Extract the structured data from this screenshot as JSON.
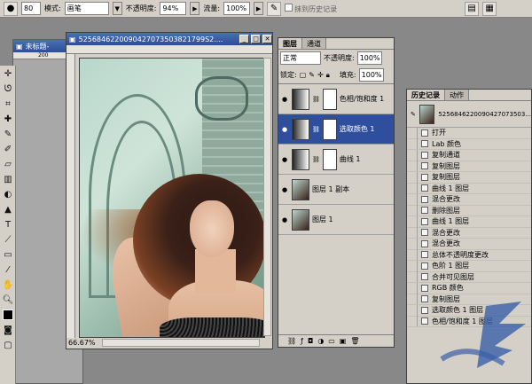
{
  "options_bar": {
    "brush_size": "80",
    "mode_label": "模式:",
    "mode_value": "画笔",
    "opacity_label": "不透明度:",
    "opacity_value": "94%",
    "flow_label": "流量:",
    "flow_value": "100%",
    "erase_history_label": "抹到历史记录"
  },
  "bg_window": {
    "title": "未标题-",
    "ruler_value": "200"
  },
  "document": {
    "title": "5256846220090427073503821799S2....",
    "zoom": "66.67%"
  },
  "layers_panel": {
    "tabs": [
      "图层",
      "通道"
    ],
    "blend_mode": "正常",
    "opacity_label": "不透明度:",
    "opacity_value": "100%",
    "lock_label": "锁定:",
    "fill_label": "填充:",
    "fill_value": "100%",
    "layers": [
      {
        "name": "色相/饱和度 1",
        "type": "adjustment",
        "selected": false
      },
      {
        "name": "选取颜色 1",
        "type": "adjustment",
        "selected": true
      },
      {
        "name": "曲线 1",
        "type": "adjustment",
        "selected": false
      },
      {
        "name": "图层 1 副本",
        "type": "image",
        "selected": false
      },
      {
        "name": "图层 1",
        "type": "image",
        "selected": false
      }
    ]
  },
  "history_panel": {
    "tabs": [
      "历史记录",
      "动作"
    ],
    "snapshot_name": "5256846220090427073503...",
    "items": [
      "打开",
      "Lab 颜色",
      "复制通道",
      "复制图层",
      "复制图层",
      "曲线 1 图层",
      "混合更改",
      "删除图层",
      "曲线 1 图层",
      "混合更改",
      "混合更改",
      "总体不透明度更改",
      "色阶 1 图层",
      "合并可见图层",
      "RGB 颜色",
      "复制图层",
      "选取颜色 1 图层",
      "色相/饱和度 1 图层"
    ]
  },
  "colors": {
    "selected_layer": "#2f4f9e",
    "titlebar": "#2a4f95",
    "panel_bg": "#d4d0c8"
  }
}
